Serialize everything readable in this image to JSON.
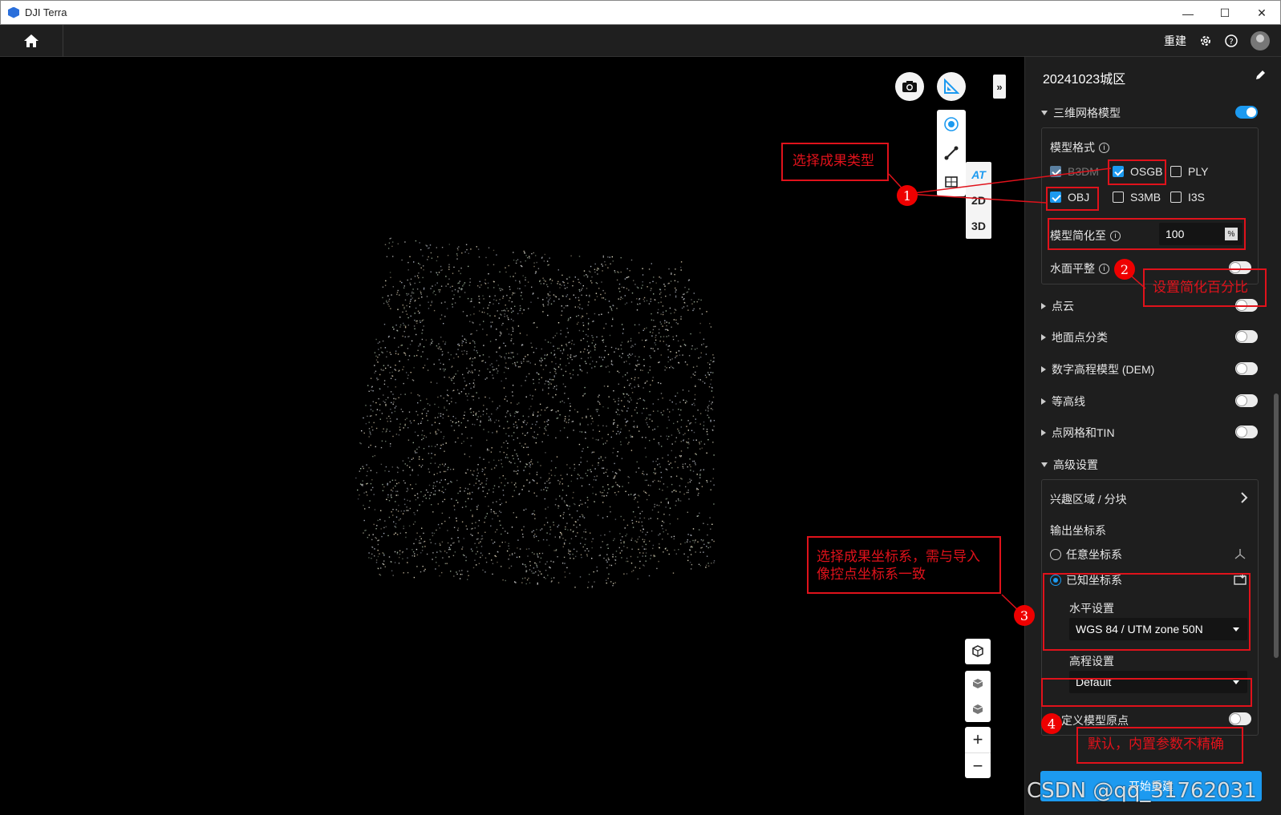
{
  "window": {
    "title": "DJI Terra"
  },
  "topbar": {
    "rebuild_label": "重建"
  },
  "viewer": {
    "view_tabs": [
      "AT",
      "2D",
      "3D"
    ],
    "zoom_in": "+",
    "zoom_out": "−"
  },
  "panel": {
    "project_title": "20241023城区",
    "mesh": {
      "label": "三维网格模型",
      "enabled": true,
      "format_label": "模型格式",
      "formats": [
        {
          "label": "B3DM",
          "checked": true,
          "disabled": true
        },
        {
          "label": "OSGB",
          "checked": true
        },
        {
          "label": "PLY",
          "checked": false
        },
        {
          "label": "OBJ",
          "checked": true
        },
        {
          "label": "S3MB",
          "checked": false
        },
        {
          "label": "I3S",
          "checked": false
        }
      ],
      "simplify_label": "模型简化至",
      "simplify_value": "100",
      "simplify_unit": "%",
      "water_label": "水面平整"
    },
    "sections": [
      {
        "label": "点云"
      },
      {
        "label": "地面点分类"
      },
      {
        "label": "数字高程模型 (DEM)"
      },
      {
        "label": "等高线"
      },
      {
        "label": "点网格和TIN"
      }
    ],
    "advanced": {
      "label": "高级设置",
      "roi_label": "兴趣区域 / 分块",
      "output_crs_label": "输出坐标系",
      "arbitrary_crs": "任意坐标系",
      "known_crs": "已知坐标系",
      "horizontal_label": "水平设置",
      "horizontal_value": "WGS 84 / UTM zone 50N",
      "elevation_label": "高程设置",
      "elevation_value": "Default",
      "custom_origin_label": "自定义模型原点"
    },
    "start_button": "开始重建"
  },
  "annotations": {
    "a1": "选择成果类型",
    "a2": "设置简化百分比",
    "a3_line1": "选择成果坐标系，需与导入",
    "a3_line2": "像控点坐标系一致",
    "a4": "默认，内置参数不精确",
    "n1": "1",
    "n2": "2",
    "n3": "3",
    "n4": "4"
  },
  "watermark": "CSDN @qq_31762031",
  "colors": {
    "accent": "#1c9af0",
    "annotation": "#e0121b"
  }
}
